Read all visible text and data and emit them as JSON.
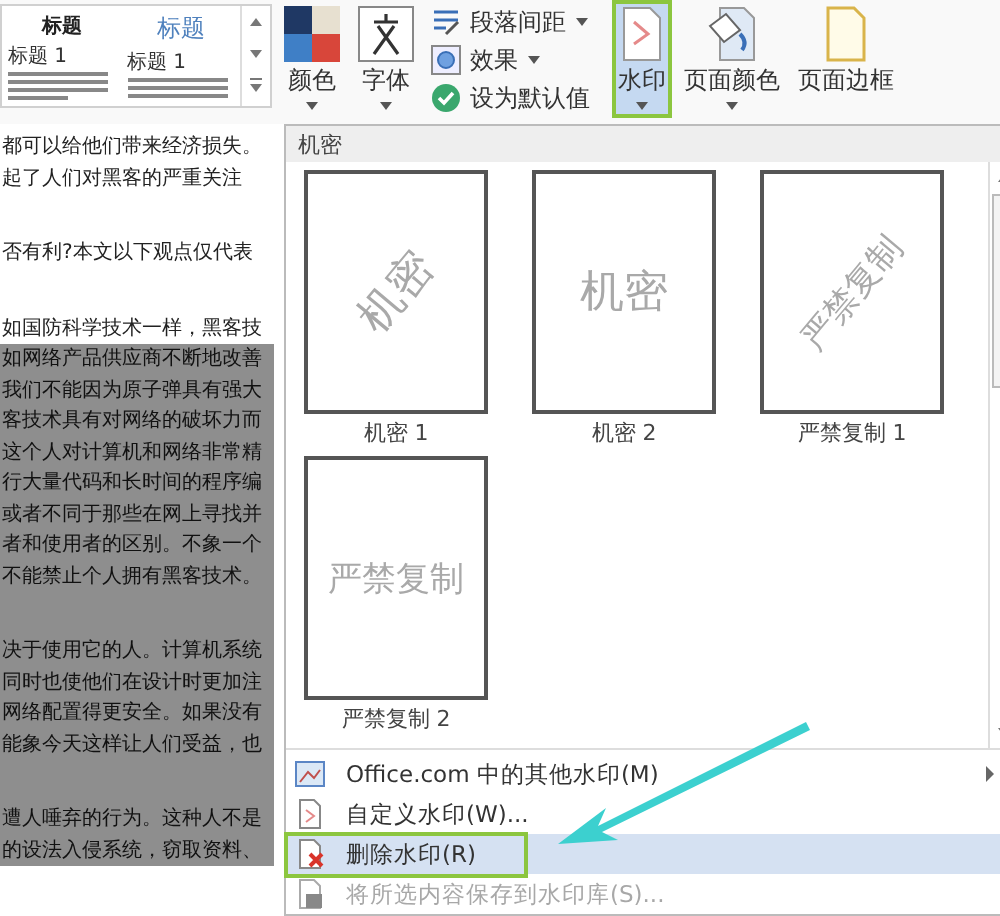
{
  "ribbon": {
    "style_gallery": [
      {
        "kind": "plain",
        "title": "标题",
        "heading": "标题 1"
      },
      {
        "kind": "accent",
        "title": "标题",
        "heading": "标题 1"
      }
    ],
    "large_buttons_left": [
      {
        "label": "颜色",
        "dropdown": true,
        "selected": false
      },
      {
        "label": "字体",
        "dropdown": true,
        "selected": false
      }
    ],
    "small_buttons": [
      {
        "label": "段落间距",
        "dropdown": true
      },
      {
        "label": "效果",
        "dropdown": true
      },
      {
        "label": "设为默认值",
        "dropdown": false
      }
    ],
    "large_buttons_right": [
      {
        "label": "水印",
        "dropdown": true,
        "selected": true,
        "callout": true
      },
      {
        "label": "页面颜色",
        "dropdown": true,
        "selected": false,
        "callout": false
      },
      {
        "label": "页面边框",
        "dropdown": false,
        "selected": false,
        "callout": false
      }
    ]
  },
  "document": {
    "lines": [
      {
        "text": "都可以给他们带来经济损失。",
        "gap_before": false,
        "shaded": false
      },
      {
        "text": "起了人们对黑客的严重关注",
        "gap_before": false,
        "shaded": false
      },
      {
        "text": "否有利?本文以下观点仅代表",
        "gap_before": true,
        "shaded": false
      },
      {
        "text": "如国防科学技术一样，黑客技",
        "gap_before": true,
        "shaded": false
      },
      {
        "text": "如网络产品供应商不断地改善",
        "gap_before": false,
        "shaded": true
      },
      {
        "text": "我们不能因为原子弹具有强大",
        "gap_before": false,
        "shaded": true
      },
      {
        "text": "客技术具有对网络的破坏力而",
        "gap_before": false,
        "shaded": true
      },
      {
        "text": "这个人对计算机和网络非常精",
        "gap_before": false,
        "shaded": true
      },
      {
        "text": "行大量代码和长时间的程序编",
        "gap_before": false,
        "shaded": true
      },
      {
        "text": "或者不同于那些在网上寻找并",
        "gap_before": false,
        "shaded": true
      },
      {
        "text": "者和使用者的区别。不象一个",
        "gap_before": false,
        "shaded": true
      },
      {
        "text": "不能禁止个人拥有黑客技术。",
        "gap_before": false,
        "shaded": true
      },
      {
        "text": "决于使用它的人。计算机系统",
        "gap_before": true,
        "shaded": true
      },
      {
        "text": "同时也使他们在设计时更加注",
        "gap_before": false,
        "shaded": true
      },
      {
        "text": "网络配置得更安全。如果没有",
        "gap_before": false,
        "shaded": true
      },
      {
        "text": "能象今天这样让人们受益，也",
        "gap_before": false,
        "shaded": true
      },
      {
        "text": "遭人唾弃的行为。这种人不是",
        "gap_before": true,
        "shaded": true
      },
      {
        "text": "的设法入侵系统，窃取资料、",
        "gap_before": false,
        "shaded": true
      }
    ]
  },
  "watermark_menu": {
    "section_title": "机密",
    "gallery": [
      {
        "preview_text": "机密",
        "rotated": true,
        "label": "机密 1"
      },
      {
        "preview_text": "机密",
        "rotated": false,
        "label": "机密 2"
      },
      {
        "preview_text": "严禁复制",
        "rotated": true,
        "label": "严禁复制 1"
      },
      {
        "preview_text": "严禁复制",
        "rotated": false,
        "label": "严禁复制 2"
      }
    ],
    "items": [
      {
        "label": "Office.com 中的其他水印(M)",
        "submenu": true,
        "highlighted": false,
        "disabled": false,
        "callout": false
      },
      {
        "label": "自定义水印(W)...",
        "submenu": false,
        "highlighted": false,
        "disabled": false,
        "callout": false
      },
      {
        "label": "删除水印(R)",
        "submenu": false,
        "highlighted": true,
        "disabled": false,
        "callout": true
      },
      {
        "label": "将所选内容保存到水印库(S)...",
        "submenu": false,
        "highlighted": false,
        "disabled": true,
        "callout": false
      }
    ]
  }
}
